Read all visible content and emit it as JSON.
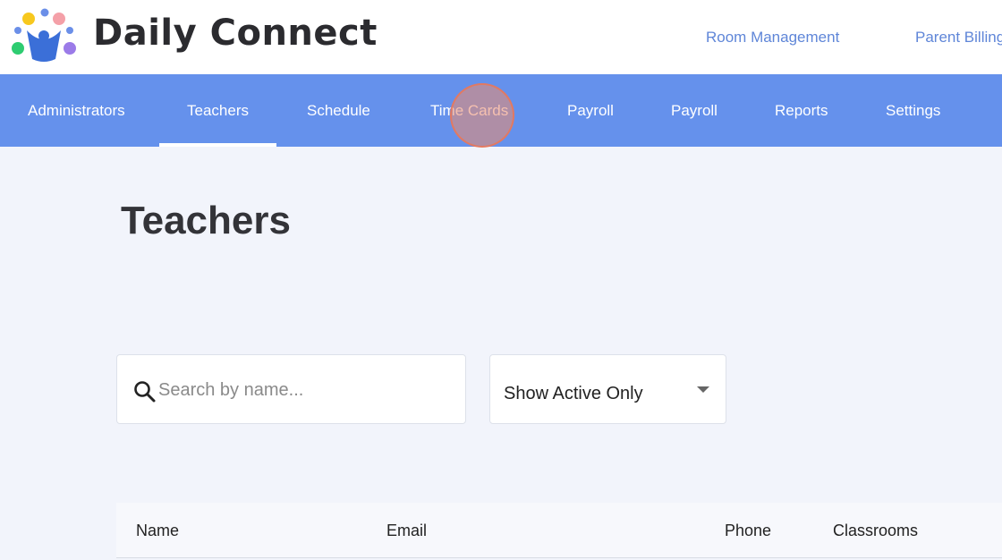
{
  "brand": {
    "name": "Daily Connect"
  },
  "top_links": {
    "room_management": "Room Management",
    "parent_billing": "Parent Billing"
  },
  "nav": {
    "items": [
      {
        "label": "Administrators"
      },
      {
        "label": "Teachers",
        "active": true
      },
      {
        "label": "Schedule"
      },
      {
        "label": "Time Cards"
      },
      {
        "label": "Payroll"
      },
      {
        "label": "Payroll"
      },
      {
        "label": "Reports"
      },
      {
        "label": "Settings"
      }
    ]
  },
  "page": {
    "title": "Teachers"
  },
  "search": {
    "placeholder": "Search by name...",
    "value": ""
  },
  "filter": {
    "selected": "Show Active Only"
  },
  "table": {
    "columns": [
      "Name",
      "Email",
      "Phone",
      "Classrooms"
    ]
  },
  "colors": {
    "nav_bg": "#6591ec",
    "accent_link": "#5f86d8",
    "page_bg": "#f2f4fb"
  }
}
